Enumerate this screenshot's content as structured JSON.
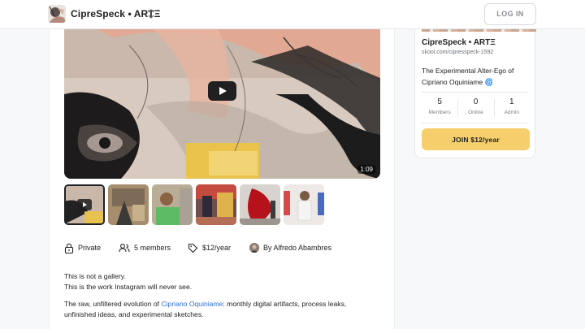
{
  "header": {
    "brand": "CipreSpeck • ARTΞ",
    "login_label": "LOG IN"
  },
  "video": {
    "duration": "1:09"
  },
  "thumbnails": [
    {
      "name": "video-thumbnail",
      "playable": true
    },
    {
      "name": "photo-thumbnail-1"
    },
    {
      "name": "photo-thumbnail-2"
    },
    {
      "name": "photo-thumbnail-3"
    },
    {
      "name": "photo-thumbnail-4"
    },
    {
      "name": "photo-thumbnail-5"
    }
  ],
  "meta": {
    "privacy": "Private",
    "members": "5 members",
    "price": "$12/year",
    "author": "By Alfredo Abambres"
  },
  "description": {
    "line1": "This is not a gallery.",
    "line2": "This is the work Instagram will never see.",
    "para2_prefix": "The raw, unfiltered evolution of ",
    "para2_link": "Cipriano Oquiniame",
    "para2_suffix": ": monthly digital artifacts, process leaks,",
    "para2_line2": "unfinished ideas, and experimental sketches."
  },
  "sidebar": {
    "title": "CipreSpeck • ARTΞ",
    "url": "skool.com/cipresspeck-1592",
    "tagline": "The Experimental Alter-Ego of Cipriano Oquiniame",
    "tagline_icon": "🌀",
    "stats": [
      {
        "value": "5",
        "label": "Members"
      },
      {
        "value": "0",
        "label": "Online"
      },
      {
        "value": "1",
        "label": "Admin"
      }
    ],
    "join_label": "JOIN $12/year"
  },
  "colors": {
    "accent": "#f6cf6c",
    "link": "#2e6fd8"
  }
}
